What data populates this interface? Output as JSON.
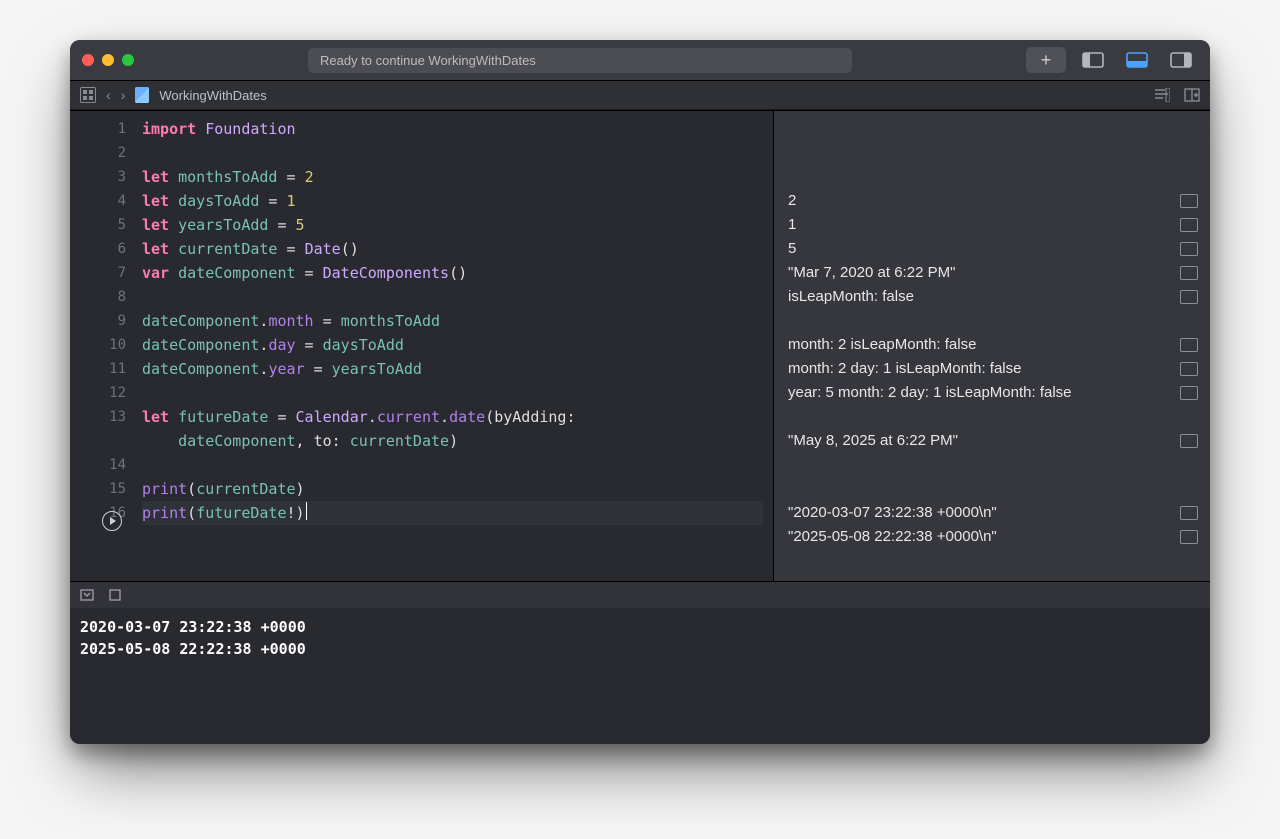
{
  "titlebar": {
    "status": "Ready to continue WorkingWithDates",
    "file_label": "WorkingWithDates"
  },
  "code": {
    "lines": [
      {
        "n": "1",
        "tokens": [
          {
            "c": "kw",
            "t": "import"
          },
          {
            "c": "op",
            "t": " "
          },
          {
            "c": "ty",
            "t": "Foundation"
          }
        ]
      },
      {
        "n": "2",
        "tokens": []
      },
      {
        "n": "3",
        "tokens": [
          {
            "c": "kw",
            "t": "let"
          },
          {
            "c": "op",
            "t": " "
          },
          {
            "c": "id",
            "t": "monthsToAdd"
          },
          {
            "c": "op",
            "t": " = "
          },
          {
            "c": "nm",
            "t": "2"
          }
        ]
      },
      {
        "n": "4",
        "tokens": [
          {
            "c": "kw",
            "t": "let"
          },
          {
            "c": "op",
            "t": " "
          },
          {
            "c": "id",
            "t": "daysToAdd"
          },
          {
            "c": "op",
            "t": " = "
          },
          {
            "c": "nm",
            "t": "1"
          }
        ]
      },
      {
        "n": "5",
        "tokens": [
          {
            "c": "kw",
            "t": "let"
          },
          {
            "c": "op",
            "t": " "
          },
          {
            "c": "id",
            "t": "yearsToAdd"
          },
          {
            "c": "op",
            "t": " = "
          },
          {
            "c": "nm",
            "t": "5"
          }
        ]
      },
      {
        "n": "6",
        "tokens": [
          {
            "c": "kw",
            "t": "let"
          },
          {
            "c": "op",
            "t": " "
          },
          {
            "c": "id",
            "t": "currentDate"
          },
          {
            "c": "op",
            "t": " = "
          },
          {
            "c": "ty",
            "t": "Date"
          },
          {
            "c": "op",
            "t": "()"
          }
        ]
      },
      {
        "n": "7",
        "tokens": [
          {
            "c": "kw",
            "t": "var"
          },
          {
            "c": "op",
            "t": " "
          },
          {
            "c": "id",
            "t": "dateComponent"
          },
          {
            "c": "op",
            "t": " = "
          },
          {
            "c": "ty",
            "t": "DateComponents"
          },
          {
            "c": "op",
            "t": "()"
          }
        ]
      },
      {
        "n": "8",
        "tokens": []
      },
      {
        "n": "9",
        "tokens": [
          {
            "c": "id",
            "t": "dateComponent"
          },
          {
            "c": "op",
            "t": "."
          },
          {
            "c": "fn",
            "t": "month"
          },
          {
            "c": "op",
            "t": " = "
          },
          {
            "c": "id",
            "t": "monthsToAdd"
          }
        ]
      },
      {
        "n": "10",
        "tokens": [
          {
            "c": "id",
            "t": "dateComponent"
          },
          {
            "c": "op",
            "t": "."
          },
          {
            "c": "fn",
            "t": "day"
          },
          {
            "c": "op",
            "t": " = "
          },
          {
            "c": "id",
            "t": "daysToAdd"
          }
        ]
      },
      {
        "n": "11",
        "tokens": [
          {
            "c": "id",
            "t": "dateComponent"
          },
          {
            "c": "op",
            "t": "."
          },
          {
            "c": "fn",
            "t": "year"
          },
          {
            "c": "op",
            "t": " = "
          },
          {
            "c": "id",
            "t": "yearsToAdd"
          }
        ]
      },
      {
        "n": "12",
        "tokens": []
      },
      {
        "n": "13",
        "tokens": [
          {
            "c": "kw",
            "t": "let"
          },
          {
            "c": "op",
            "t": " "
          },
          {
            "c": "id",
            "t": "futureDate"
          },
          {
            "c": "op",
            "t": " = "
          },
          {
            "c": "ty",
            "t": "Calendar"
          },
          {
            "c": "op",
            "t": "."
          },
          {
            "c": "fn",
            "t": "current"
          },
          {
            "c": "op",
            "t": "."
          },
          {
            "c": "fn",
            "t": "date"
          },
          {
            "c": "op",
            "t": "(byAdding:"
          }
        ]
      },
      {
        "n": "",
        "tokens": [
          {
            "c": "op",
            "t": "    "
          },
          {
            "c": "id",
            "t": "dateComponent"
          },
          {
            "c": "op",
            "t": ", to: "
          },
          {
            "c": "id",
            "t": "currentDate"
          },
          {
            "c": "op",
            "t": ")"
          }
        ]
      },
      {
        "n": "14",
        "tokens": []
      },
      {
        "n": "15",
        "tokens": [
          {
            "c": "fn",
            "t": "print"
          },
          {
            "c": "op",
            "t": "("
          },
          {
            "c": "id",
            "t": "currentDate"
          },
          {
            "c": "op",
            "t": ")"
          }
        ]
      },
      {
        "n": "16",
        "tokens": [
          {
            "c": "fn",
            "t": "print"
          },
          {
            "c": "op",
            "t": "("
          },
          {
            "c": "id",
            "t": "futureDate"
          },
          {
            "c": "op",
            "t": "!)"
          }
        ],
        "current": true
      }
    ]
  },
  "results": [
    {
      "blank": true
    },
    {
      "text": "2",
      "peek": true
    },
    {
      "text": "1",
      "peek": true
    },
    {
      "text": "5",
      "peek": true
    },
    {
      "text": "\"Mar 7, 2020 at 6:22 PM\"",
      "peek": true
    },
    {
      "text": "isLeapMonth: false",
      "peek": true
    },
    {
      "blank": true
    },
    {
      "text": "month: 2 isLeapMonth: false",
      "peek": true
    },
    {
      "text": "month: 2 day: 1 isLeapMonth: false",
      "peek": true
    },
    {
      "text": "year: 5 month: 2 day: 1 isLeapMonth: false",
      "peek": true
    },
    {
      "blank": true
    },
    {
      "text": "\"May 8, 2025 at 6:22 PM\"",
      "peek": true
    },
    {
      "blank": true
    },
    {
      "blank": true
    },
    {
      "text": "\"2020-03-07 23:22:38 +0000\\n\"",
      "peek": true
    },
    {
      "text": "\"2025-05-08 22:22:38 +0000\\n\"",
      "peek": true
    }
  ],
  "console": {
    "lines": [
      "2020-03-07 23:22:38 +0000",
      "2025-05-08 22:22:38 +0000"
    ]
  }
}
